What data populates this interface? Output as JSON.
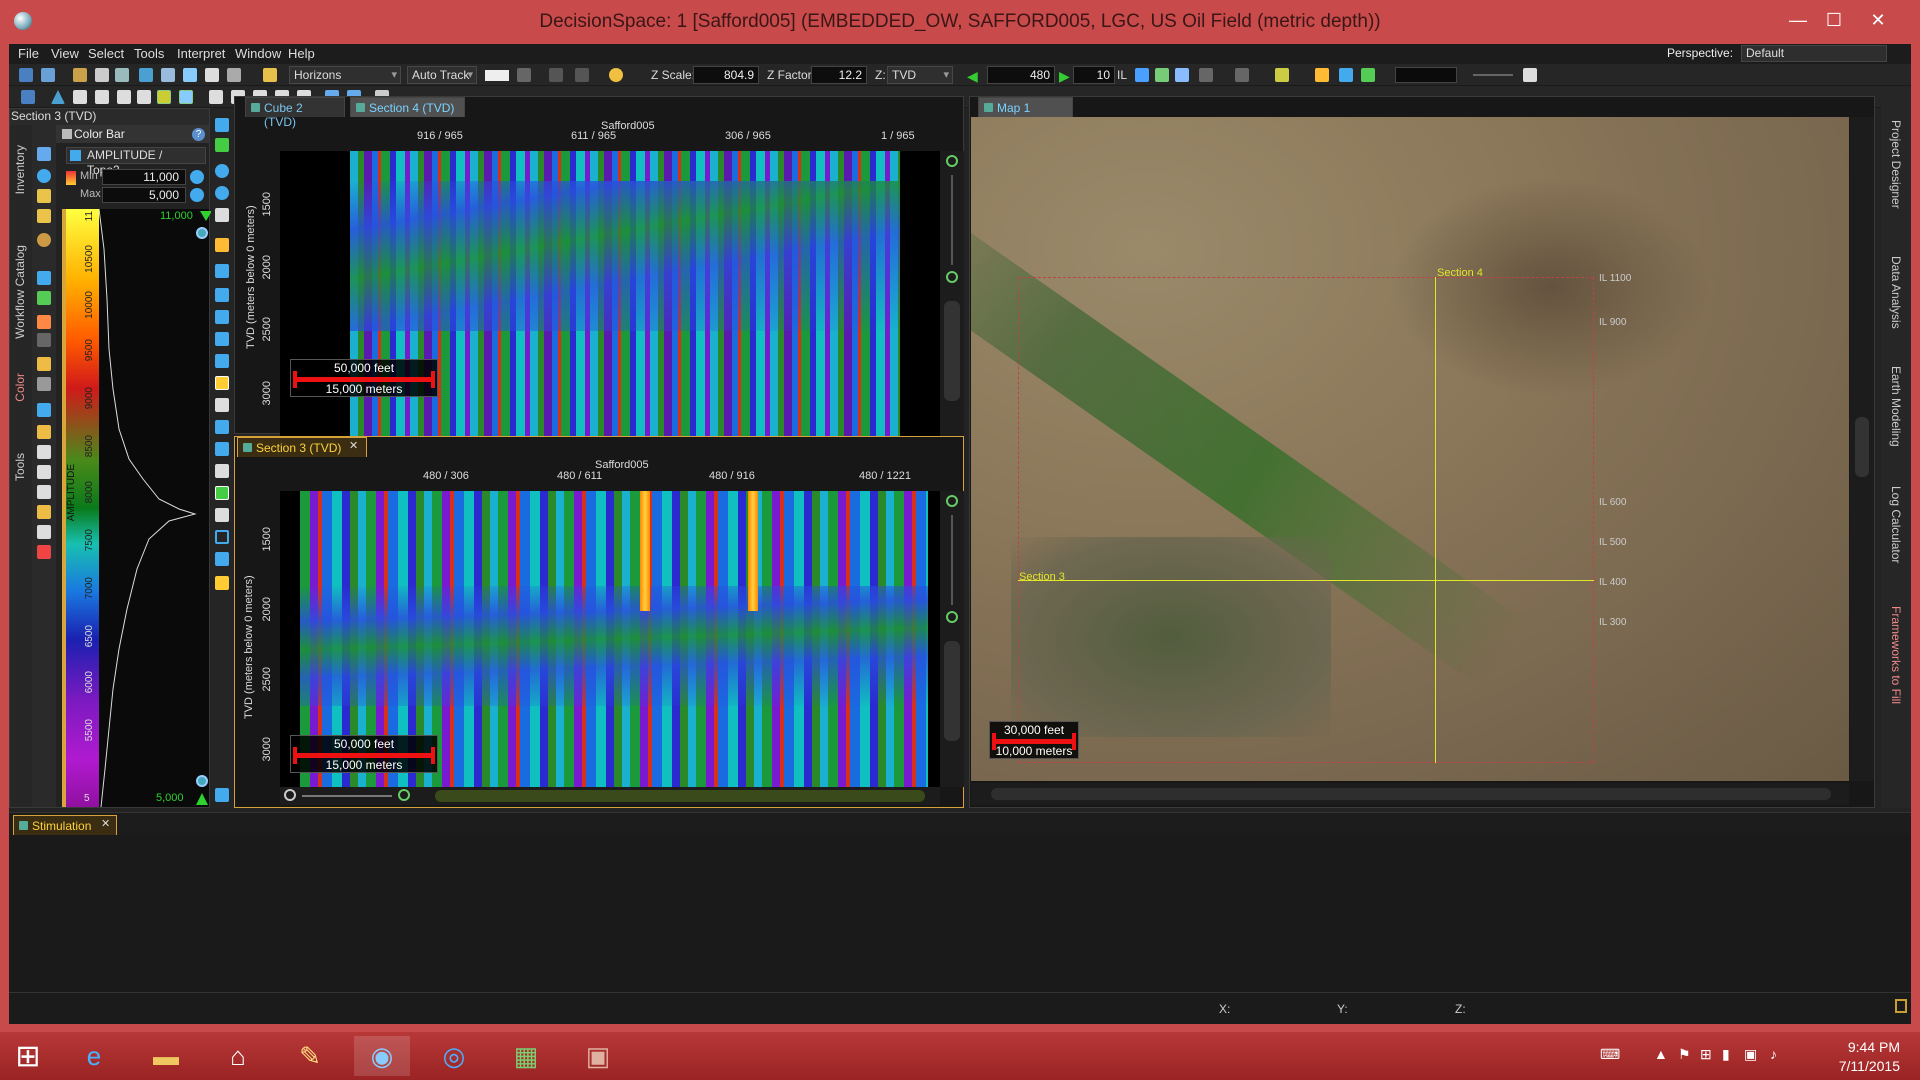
{
  "window": {
    "title": "DecisionSpace: 1 [Safford005] (EMBEDDED_OW, SAFFORD005, LGC, US Oil Field (metric depth))",
    "minimize": "—",
    "maximize": "☐",
    "close": "✕"
  },
  "menu": {
    "items": [
      "File",
      "View",
      "Select",
      "Tools",
      "Interpret",
      "Window",
      "Help"
    ],
    "perspective_label": "Perspective:",
    "perspective_value": "Default"
  },
  "toolbar": {
    "horizons": "Horizons",
    "auto_track": "Auto Track",
    "zscale_label": "Z Scale:",
    "zscale_value": "804.9",
    "zfactor_label": "Z Factor:",
    "zfactor_value": "12.2",
    "z_label": "Z:",
    "z_value": "TVD",
    "line_value": "480",
    "step_value": "10",
    "il_label": "IL"
  },
  "left_panel": {
    "header": "Section 3 (TVD)",
    "colorbar_title": "Color Bar",
    "attribute": "AMPLITUDE / Topo2...",
    "min_label": "Min",
    "min_value": "11,000",
    "max_label": "Max",
    "max_value": "5,000",
    "top_value": "11,000",
    "bottom_value": "5,000",
    "axis_title": "AMPLITUDE",
    "ticks": [
      "11",
      "10500",
      "10000",
      "9500",
      "9000",
      "8500",
      "8000",
      "7500",
      "7000",
      "6500",
      "6000",
      "5500",
      "5"
    ],
    "vtabs": [
      "Inventory",
      "Workflow Catalog",
      "Color",
      "Tools"
    ]
  },
  "section_top": {
    "tabs": [
      "Cube 2 (TVD)",
      "Section 4 (TVD)"
    ],
    "survey": "Safford005",
    "xlabels": [
      "916 / 965",
      "611 / 965",
      "306 / 965",
      "1 / 965"
    ],
    "ylabel": "TVD (meters below 0 meters)",
    "yticks": [
      "1500",
      "2000",
      "2500",
      "3000"
    ],
    "scale_feet": "50,000 feet",
    "scale_meters": "15,000 meters"
  },
  "section_bottom": {
    "tab": "Section 3 (TVD)",
    "close": "✕",
    "survey": "Safford005",
    "xlabels": [
      "480 / 306",
      "480 / 611",
      "480 / 916",
      "480 / 1221"
    ],
    "ylabel": "TVD (meters below 0 meters)",
    "yticks": [
      "1500",
      "2000",
      "2500",
      "3000"
    ],
    "scale_feet": "50,000 feet",
    "scale_meters": "15,000 meters"
  },
  "map": {
    "tab": "Map 1 (TVD)",
    "section4_label": "Section 4",
    "section3_label": "Section 3",
    "il_labels": [
      "IL 1100",
      "IL 900",
      "IL 600",
      "IL 500",
      "IL 400",
      "IL 300"
    ],
    "scale_feet": "30,000 feet",
    "scale_meters": "10,000 meters"
  },
  "right_vtabs": [
    "Project Designer",
    "Data Analysis",
    "Earth Modeling",
    "Log Calculator",
    "Frameworks to Fill"
  ],
  "bottom_panel": {
    "tab": "Stimulation",
    "close": "✕",
    "x_label": "X:",
    "y_label": "Y:",
    "z_label": "Z:"
  },
  "taskbar": {
    "time": "9:44 PM",
    "date": "7/11/2015"
  },
  "colors": {
    "accent": "#79d3ff",
    "frame": "#c84a4a",
    "section_label": "#e5e52a"
  }
}
